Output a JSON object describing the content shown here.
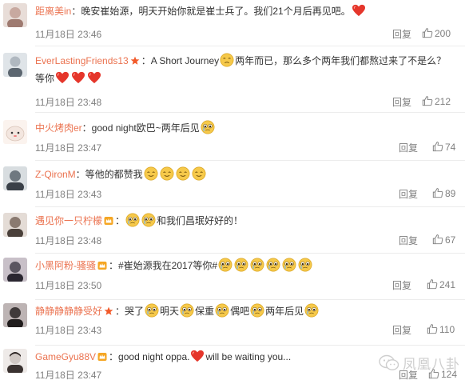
{
  "comments": [
    {
      "username": "距离美in",
      "text": "：晚安崔始源，明天开始你就是崔士兵了。我们21个月后再见吧。",
      "timestamp": "11月18日 23:46",
      "reply_label": "回复",
      "likes": "200",
      "avatar_color": "#c8a9a0"
    },
    {
      "username": "EverLastingFriends13",
      "text_a": "：A Short Journey",
      "text_b": "两年而已，那么多个两年我们都熬过来了不是么？",
      "text_line2": "等你",
      "timestamp": "11月18日 23:48",
      "reply_label": "回复",
      "likes": "212",
      "avatar_color": "#b0b8c0"
    },
    {
      "username": "中火烤肉er",
      "text": "：good night欧巴~两年后见",
      "timestamp": "11月18日 23:47",
      "reply_label": "回复",
      "likes": "74",
      "avatar_color": "#f3e6df"
    },
    {
      "username": "Z-QironM",
      "text": "：等他的都赞我",
      "timestamp": "11月18日 23:43",
      "reply_label": "回复",
      "likes": "89",
      "avatar_color": "#6f7880"
    },
    {
      "username": "遇见你一只柠檬",
      "text": "和我们昌珉好好的！",
      "timestamp": "11月18日 23:48",
      "reply_label": "回复",
      "likes": "67",
      "avatar_color": "#8a7a70"
    },
    {
      "username": "小黑阿粉-骚骚",
      "text": "：#崔始源我在2017等你#",
      "timestamp": "11月18日 23:50",
      "reply_label": "回复",
      "likes": "241",
      "avatar_color": "#5a5560"
    },
    {
      "username": "静静静静静受好",
      "text_a": "：哭了",
      "text_b": "明天",
      "text_c": "保重",
      "text_d": "偶吧",
      "text_e": "两年后见",
      "timestamp": "11月18日 23:43",
      "reply_label": "回复",
      "likes": "110",
      "avatar_color": "#403a3a"
    },
    {
      "username": "GameGyu88V",
      "text_a": "：good night oppa.",
      "text_b": "will be waiting you...",
      "timestamp": "11月18日 23:47",
      "reply_label": "回复",
      "likes": "124",
      "avatar_color": "#d0c8c4"
    }
  ],
  "watermark": {
    "text": "凤凰八卦",
    "icon": "wechat-icon"
  },
  "colors": {
    "username": "#eb7350",
    "meta": "#808080",
    "heart": "#e5362b",
    "emoji_face": "#f6c94a"
  }
}
